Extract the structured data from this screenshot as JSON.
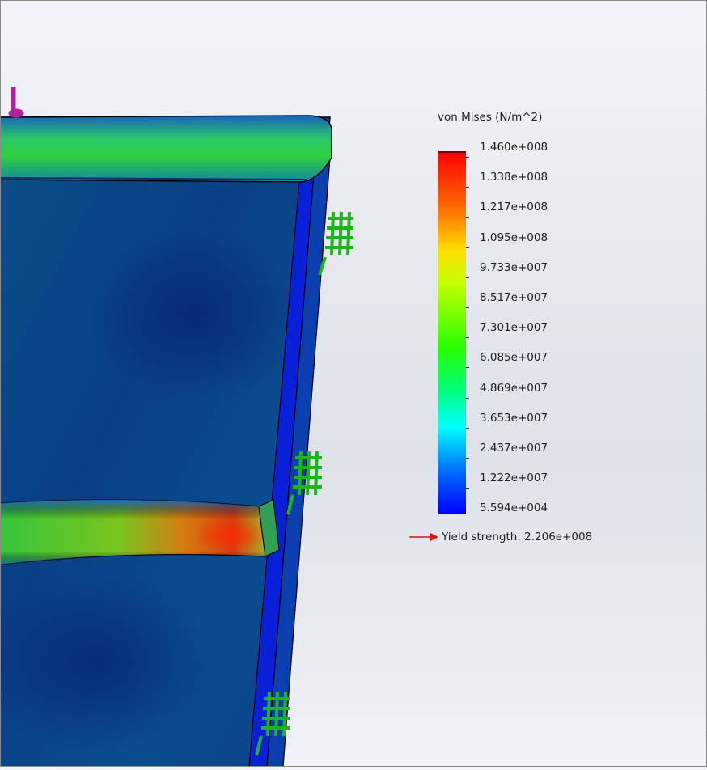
{
  "legend": {
    "title": "von Mises (N/m^2)",
    "ticks": [
      "1.460e+008",
      "1.338e+008",
      "1.217e+008",
      "1.095e+008",
      "9.733e+007",
      "8.517e+007",
      "7.301e+007",
      "6.085e+007",
      "4.869e+007",
      "3.653e+007",
      "2.437e+007",
      "1.222e+007",
      "5.594e+004"
    ],
    "yield_label": "Yield strength: 2.206e+008"
  },
  "colors": {
    "max": "#ff0000",
    "min": "#0000ff",
    "fixture": "#1fb31f",
    "load_arrow": "#b0209f",
    "yield_arrow": "#e01010"
  },
  "icons": {
    "fixture": "fixed-geometry-icon",
    "load": "force-arrow-icon",
    "yield": "red-arrow-icon"
  }
}
